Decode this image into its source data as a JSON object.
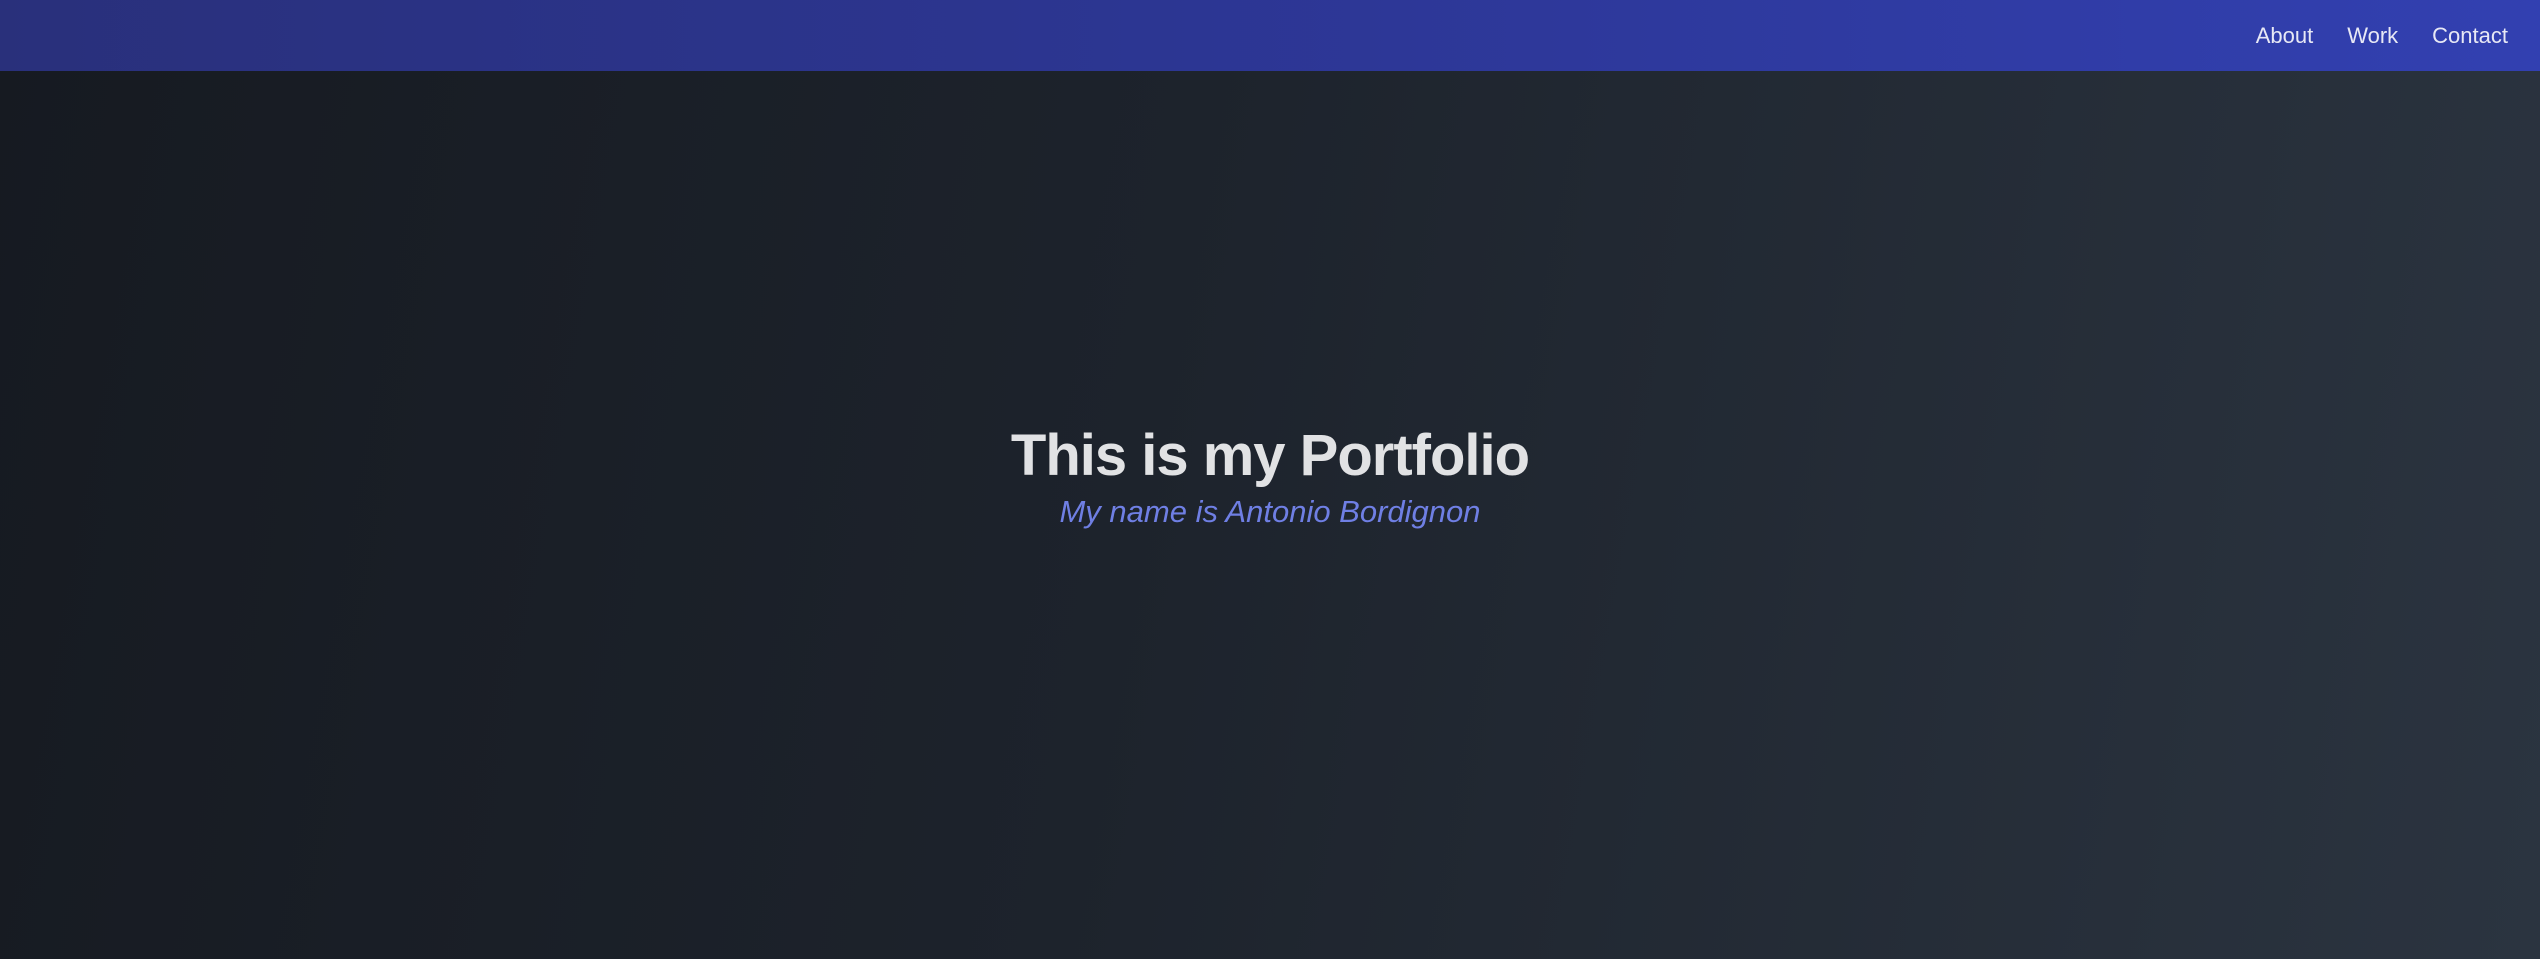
{
  "nav": {
    "links": [
      {
        "label": "About"
      },
      {
        "label": "Work"
      },
      {
        "label": "Contact"
      }
    ]
  },
  "hero": {
    "title": "This is my Portfolio",
    "subtitle": "My name is Antonio Bordignon"
  },
  "colors": {
    "navbar": "#2d3797",
    "background": "#1d232c",
    "title": "#e1e2e4",
    "subtitle": "#6f7fe4"
  }
}
